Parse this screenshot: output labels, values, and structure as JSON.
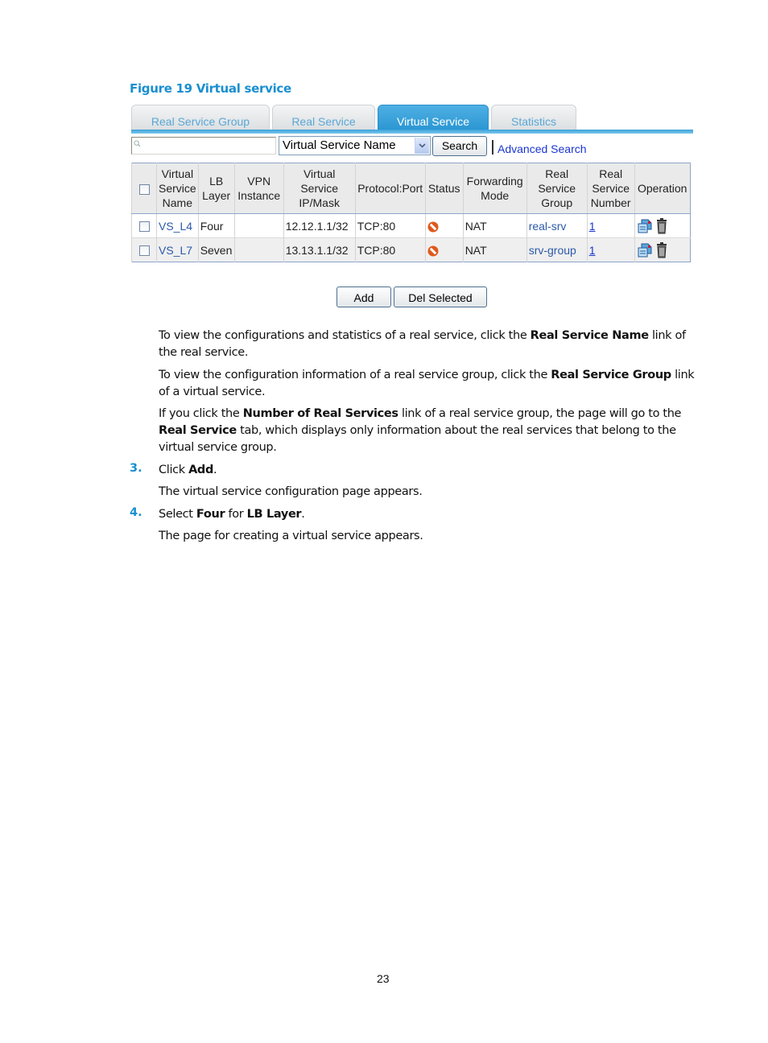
{
  "figure": {
    "title": "Figure 19 Virtual service"
  },
  "tabs": [
    {
      "label": "Real Service Group",
      "active": false
    },
    {
      "label": "Real Service",
      "active": false
    },
    {
      "label": "Virtual Service",
      "active": true
    },
    {
      "label": "Statistics",
      "active": false
    }
  ],
  "search": {
    "input_value": "",
    "field_select": "Virtual Service Name",
    "search_label": "Search",
    "advanced_label": "Advanced Search"
  },
  "table": {
    "headers": [
      "Virtual Service Name",
      "LB Layer",
      "VPN Instance",
      "Virtual Service IP/Mask",
      "Protocol:Port",
      "Status",
      "Forwarding Mode",
      "Real Service Group",
      "Real Service Number",
      "Operation"
    ],
    "header_lines": [
      [
        "Virtual",
        "Service",
        "Name"
      ],
      [
        "LB",
        "Layer"
      ],
      [
        "VPN",
        "Instance"
      ],
      [
        "Virtual",
        "Service",
        "IP/Mask"
      ],
      [
        "Protocol:Port"
      ],
      [
        "Status"
      ],
      [
        "Forwarding",
        "Mode"
      ],
      [
        "Real",
        "Service",
        "Group"
      ],
      [
        "Real",
        "Service",
        "Number"
      ],
      [
        "Operation"
      ]
    ],
    "rows": [
      {
        "name": "VS_L4",
        "lb_layer": "Four",
        "vpn": "",
        "ip_mask": "12.12.1.1/32",
        "protocol_port": "TCP:80",
        "status": "disabled-icon",
        "forwarding": "NAT",
        "group": "real-srv",
        "number": "1"
      },
      {
        "name": "VS_L7",
        "lb_layer": "Seven",
        "vpn": "",
        "ip_mask": "13.13.1.1/32",
        "protocol_port": "TCP:80",
        "status": "disabled-icon",
        "forwarding": "NAT",
        "group": "srv-group",
        "number": "1"
      }
    ]
  },
  "actions": {
    "add_label": "Add",
    "del_label": "Del Selected"
  },
  "text": {
    "p1": {
      "a": "To view the configurations and statistics of a real service, click the ",
      "b": "Real Service Name",
      "c": " link of the real service."
    },
    "p2": {
      "a": "To view the configuration information of a real service group, click the ",
      "b": "Real Service Group",
      "c": " link of a virtual service."
    },
    "p3": {
      "a": "If you click the ",
      "b": "Number of Real Services",
      "c": " link of a real service group, the page will go to the ",
      "d": "Real Service",
      "e": " tab, which displays only information about the real services that belong to the virtual service group."
    },
    "step3": {
      "num": "3.",
      "a": "Click ",
      "b": "Add",
      "c": ".",
      "sub": "The virtual service configuration page appears."
    },
    "step4": {
      "num": "4.",
      "a": "Select ",
      "b": "Four",
      "c": " for ",
      "d": "LB Layer",
      "e": ".",
      "sub": "The page for creating a virtual service appears."
    }
  },
  "page_number": "23"
}
